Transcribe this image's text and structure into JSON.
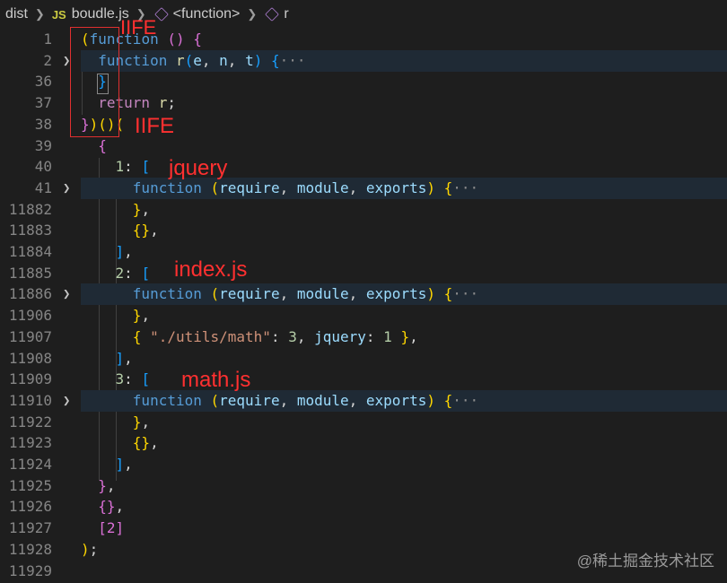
{
  "breadcrumb": {
    "folder": "dist",
    "js_badge": "JS",
    "file": "boudle.js",
    "symbol1": "<function>",
    "symbol2": "r"
  },
  "lines": [
    {
      "ln": "1",
      "fold": false,
      "hl": false,
      "tokens": [
        {
          "t": "(",
          "c": "b1"
        },
        {
          "t": "function",
          "c": "k"
        },
        {
          "t": " ",
          "c": ""
        },
        {
          "t": "()",
          "c": "b2"
        },
        {
          "t": " ",
          "c": ""
        },
        {
          "t": "{",
          "c": "b2"
        }
      ]
    },
    {
      "ln": "2",
      "fold": true,
      "hl": true,
      "tokens": [
        {
          "t": "  ",
          "c": ""
        },
        {
          "t": "function",
          "c": "k"
        },
        {
          "t": " ",
          "c": ""
        },
        {
          "t": "r",
          "c": "f"
        },
        {
          "t": "(",
          "c": "b3"
        },
        {
          "t": "e",
          "c": "p"
        },
        {
          "t": ", ",
          "c": ""
        },
        {
          "t": "n",
          "c": "p"
        },
        {
          "t": ", ",
          "c": ""
        },
        {
          "t": "t",
          "c": "p"
        },
        {
          "t": ")",
          "c": "b3"
        },
        {
          "t": " ",
          "c": ""
        },
        {
          "t": "{",
          "c": "b3"
        },
        {
          "t": "···",
          "c": "ell"
        }
      ]
    },
    {
      "ln": "36",
      "fold": false,
      "hl": false,
      "tokens": [
        {
          "t": "  ",
          "c": ""
        },
        {
          "t": "}",
          "c": "b3"
        }
      ]
    },
    {
      "ln": "37",
      "fold": false,
      "hl": false,
      "tokens": [
        {
          "t": "  ",
          "c": ""
        },
        {
          "t": "return",
          "c": "c"
        },
        {
          "t": " ",
          "c": ""
        },
        {
          "t": "r",
          "c": "f"
        },
        {
          "t": ";",
          "c": ""
        }
      ]
    },
    {
      "ln": "38",
      "fold": false,
      "hl": false,
      "tokens": [
        {
          "t": "}",
          "c": "b2"
        },
        {
          "t": ")",
          "c": "b1"
        },
        {
          "t": "()",
          "c": "b1"
        },
        {
          "t": "(",
          "c": "b1"
        }
      ]
    },
    {
      "ln": "39",
      "fold": false,
      "hl": false,
      "tokens": [
        {
          "t": "  ",
          "c": ""
        },
        {
          "t": "{",
          "c": "b2"
        }
      ]
    },
    {
      "ln": "40",
      "fold": false,
      "hl": false,
      "tokens": [
        {
          "t": "    ",
          "c": ""
        },
        {
          "t": "1",
          "c": "n"
        },
        {
          "t": ": ",
          "c": ""
        },
        {
          "t": "[",
          "c": "b3"
        }
      ]
    },
    {
      "ln": "41",
      "fold": true,
      "hl": true,
      "tokens": [
        {
          "t": "      ",
          "c": ""
        },
        {
          "t": "function",
          "c": "k"
        },
        {
          "t": " ",
          "c": ""
        },
        {
          "t": "(",
          "c": "b1"
        },
        {
          "t": "require",
          "c": "p"
        },
        {
          "t": ", ",
          "c": ""
        },
        {
          "t": "module",
          "c": "p"
        },
        {
          "t": ", ",
          "c": ""
        },
        {
          "t": "exports",
          "c": "p"
        },
        {
          "t": ")",
          "c": "b1"
        },
        {
          "t": " ",
          "c": ""
        },
        {
          "t": "{",
          "c": "b1"
        },
        {
          "t": "···",
          "c": "ell"
        }
      ]
    },
    {
      "ln": "11882",
      "fold": false,
      "hl": false,
      "tokens": [
        {
          "t": "      ",
          "c": ""
        },
        {
          "t": "}",
          "c": "b1"
        },
        {
          "t": ",",
          "c": ""
        }
      ]
    },
    {
      "ln": "11883",
      "fold": false,
      "hl": false,
      "tokens": [
        {
          "t": "      ",
          "c": ""
        },
        {
          "t": "{}",
          "c": "b1"
        },
        {
          "t": ",",
          "c": ""
        }
      ]
    },
    {
      "ln": "11884",
      "fold": false,
      "hl": false,
      "tokens": [
        {
          "t": "    ",
          "c": ""
        },
        {
          "t": "]",
          "c": "b3"
        },
        {
          "t": ",",
          "c": ""
        }
      ]
    },
    {
      "ln": "11885",
      "fold": false,
      "hl": false,
      "tokens": [
        {
          "t": "    ",
          "c": ""
        },
        {
          "t": "2",
          "c": "n"
        },
        {
          "t": ": ",
          "c": ""
        },
        {
          "t": "[",
          "c": "b3"
        }
      ]
    },
    {
      "ln": "11886",
      "fold": true,
      "hl": true,
      "tokens": [
        {
          "t": "      ",
          "c": ""
        },
        {
          "t": "function",
          "c": "k"
        },
        {
          "t": " ",
          "c": ""
        },
        {
          "t": "(",
          "c": "b1"
        },
        {
          "t": "require",
          "c": "p"
        },
        {
          "t": ", ",
          "c": ""
        },
        {
          "t": "module",
          "c": "p"
        },
        {
          "t": ", ",
          "c": ""
        },
        {
          "t": "exports",
          "c": "p"
        },
        {
          "t": ")",
          "c": "b1"
        },
        {
          "t": " ",
          "c": ""
        },
        {
          "t": "{",
          "c": "b1"
        },
        {
          "t": "···",
          "c": "ell"
        }
      ]
    },
    {
      "ln": "11906",
      "fold": false,
      "hl": false,
      "tokens": [
        {
          "t": "      ",
          "c": ""
        },
        {
          "t": "}",
          "c": "b1"
        },
        {
          "t": ",",
          "c": ""
        }
      ]
    },
    {
      "ln": "11907",
      "fold": false,
      "hl": false,
      "tokens": [
        {
          "t": "      ",
          "c": ""
        },
        {
          "t": "{",
          "c": "b1"
        },
        {
          "t": " ",
          "c": ""
        },
        {
          "t": "\"./utils/math\"",
          "c": "s"
        },
        {
          "t": ": ",
          "c": ""
        },
        {
          "t": "3",
          "c": "n"
        },
        {
          "t": ", ",
          "c": ""
        },
        {
          "t": "jquery",
          "c": "p"
        },
        {
          "t": ": ",
          "c": ""
        },
        {
          "t": "1",
          "c": "n"
        },
        {
          "t": " ",
          "c": ""
        },
        {
          "t": "}",
          "c": "b1"
        },
        {
          "t": ",",
          "c": ""
        }
      ]
    },
    {
      "ln": "11908",
      "fold": false,
      "hl": false,
      "tokens": [
        {
          "t": "    ",
          "c": ""
        },
        {
          "t": "]",
          "c": "b3"
        },
        {
          "t": ",",
          "c": ""
        }
      ]
    },
    {
      "ln": "11909",
      "fold": false,
      "hl": false,
      "tokens": [
        {
          "t": "    ",
          "c": ""
        },
        {
          "t": "3",
          "c": "n"
        },
        {
          "t": ": ",
          "c": ""
        },
        {
          "t": "[",
          "c": "b3"
        }
      ]
    },
    {
      "ln": "11910",
      "fold": true,
      "hl": true,
      "tokens": [
        {
          "t": "      ",
          "c": ""
        },
        {
          "t": "function",
          "c": "k"
        },
        {
          "t": " ",
          "c": ""
        },
        {
          "t": "(",
          "c": "b1"
        },
        {
          "t": "require",
          "c": "p"
        },
        {
          "t": ", ",
          "c": ""
        },
        {
          "t": "module",
          "c": "p"
        },
        {
          "t": ", ",
          "c": ""
        },
        {
          "t": "exports",
          "c": "p"
        },
        {
          "t": ")",
          "c": "b1"
        },
        {
          "t": " ",
          "c": ""
        },
        {
          "t": "{",
          "c": "b1"
        },
        {
          "t": "···",
          "c": "ell"
        }
      ]
    },
    {
      "ln": "11922",
      "fold": false,
      "hl": false,
      "tokens": [
        {
          "t": "      ",
          "c": ""
        },
        {
          "t": "}",
          "c": "b1"
        },
        {
          "t": ",",
          "c": ""
        }
      ]
    },
    {
      "ln": "11923",
      "fold": false,
      "hl": false,
      "tokens": [
        {
          "t": "      ",
          "c": ""
        },
        {
          "t": "{}",
          "c": "b1"
        },
        {
          "t": ",",
          "c": ""
        }
      ]
    },
    {
      "ln": "11924",
      "fold": false,
      "hl": false,
      "tokens": [
        {
          "t": "    ",
          "c": ""
        },
        {
          "t": "]",
          "c": "b3"
        },
        {
          "t": ",",
          "c": ""
        }
      ]
    },
    {
      "ln": "11925",
      "fold": false,
      "hl": false,
      "tokens": [
        {
          "t": "  ",
          "c": ""
        },
        {
          "t": "}",
          "c": "b2"
        },
        {
          "t": ",",
          "c": ""
        }
      ]
    },
    {
      "ln": "11926",
      "fold": false,
      "hl": false,
      "tokens": [
        {
          "t": "  ",
          "c": ""
        },
        {
          "t": "{}",
          "c": "b2"
        },
        {
          "t": ",",
          "c": ""
        }
      ]
    },
    {
      "ln": "11927",
      "fold": false,
      "hl": false,
      "tokens": [
        {
          "t": "  ",
          "c": ""
        },
        {
          "t": "[2]",
          "c": "b2"
        }
      ]
    },
    {
      "ln": "11928",
      "fold": false,
      "hl": false,
      "tokens": [
        {
          "t": ")",
          "c": "b1"
        },
        {
          "t": ";",
          "c": ""
        }
      ]
    },
    {
      "ln": "11929",
      "fold": false,
      "hl": false,
      "tokens": []
    }
  ],
  "annotations": {
    "iife_top": "IIFE",
    "iife_call": "IIFE",
    "jquery": "jquery",
    "index": "index.js",
    "math": "math.js"
  },
  "watermark": "@稀土掘金技术社区",
  "colors": {
    "background": "#1e1e1e",
    "annotation": "#ff3030",
    "keyword": "#569cd6"
  }
}
